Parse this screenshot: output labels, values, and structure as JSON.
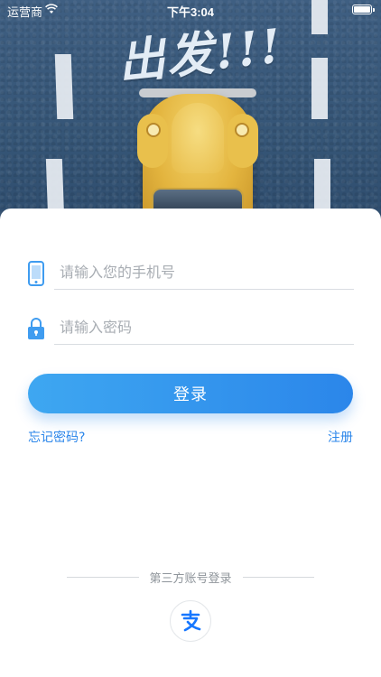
{
  "status_bar": {
    "carrier": "运营商",
    "time": "下午3:04"
  },
  "hero": {
    "title": "出发!!!"
  },
  "login": {
    "phone_placeholder": "请输入您的手机号",
    "password_placeholder": "请输入密码",
    "submit_label": "登录",
    "forgot_label": "忘记密码?",
    "register_label": "注册"
  },
  "third_party": {
    "label": "第三方账号登录",
    "providers": [
      {
        "icon": "alipay-icon"
      }
    ]
  },
  "colors": {
    "accent": "#2b86ea",
    "accent_light": "#3ea7f1",
    "alipay": "#1677ff"
  }
}
